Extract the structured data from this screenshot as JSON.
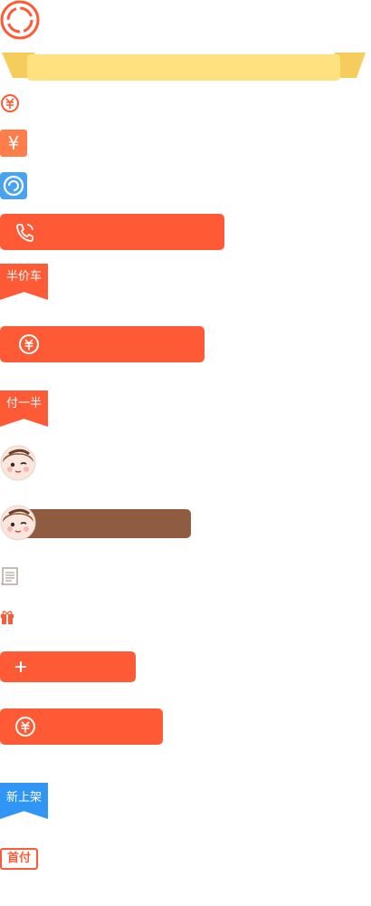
{
  "colors": {
    "accent": "#ff5a36",
    "banner": "#ffe27f",
    "banner_fold": "#f6cd5c",
    "blue_badge": "#3096f5",
    "tile_blue": "#4aa3ef",
    "brown_bar": "#8f5c41"
  },
  "icons": {
    "ring": "ring-icon",
    "yuan_circle": "yuan-circle-icon",
    "yuan_tile": "yuan-tile-icon",
    "swirl_tile": "swirl-tile-icon",
    "phone": "phone-icon",
    "avatar": "avatar-icon",
    "notebook": "notebook-icon",
    "gift": "gift-icon",
    "plus": "plus-icon"
  },
  "labels": {
    "yuan_tile_glyph": "¥",
    "half_price_car": "半价车",
    "pay_half": "付一半",
    "new_arrival": "新上架",
    "pay_stamp": "首付"
  }
}
